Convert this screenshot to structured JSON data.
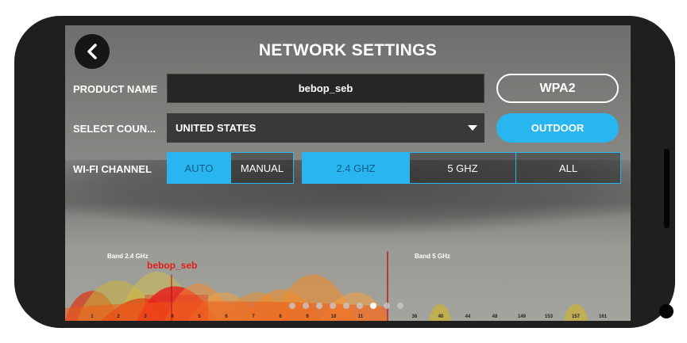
{
  "header": {
    "title": "NETWORK SETTINGS"
  },
  "product": {
    "label": "PRODUCT NAME",
    "value": "bebop_seb",
    "security_button": "WPA2"
  },
  "country": {
    "label": "SELECT COUN...",
    "value": "UNITED STATES",
    "location_button": "OUTDOOR"
  },
  "wifi": {
    "label": "WI-FI CHANNEL",
    "modes": [
      "AUTO",
      "MANUAL"
    ],
    "selected_mode": "AUTO",
    "bands": [
      "2.4 GHZ",
      "5 GHZ",
      "ALL"
    ],
    "selected_band": "2.4 GHZ"
  },
  "spectrum": {
    "band_24_label": "Band 2.4 GHz",
    "band_5_label": "Band 5 GHz",
    "network_name": "bebop_seb",
    "channels_24": [
      "1",
      "2",
      "3",
      "4",
      "5",
      "6",
      "7",
      "8",
      "9",
      "10",
      "11"
    ],
    "channels_5": [
      "36",
      "40",
      "44",
      "48",
      "149",
      "153",
      "157",
      "161"
    ]
  },
  "pager": {
    "count": 9,
    "active_index": 6
  },
  "colors": {
    "accent": "#29b6f0",
    "network": "#e51c1c"
  },
  "icons": {
    "back": "chevron-left-icon",
    "dropdown": "caret-down-icon"
  }
}
